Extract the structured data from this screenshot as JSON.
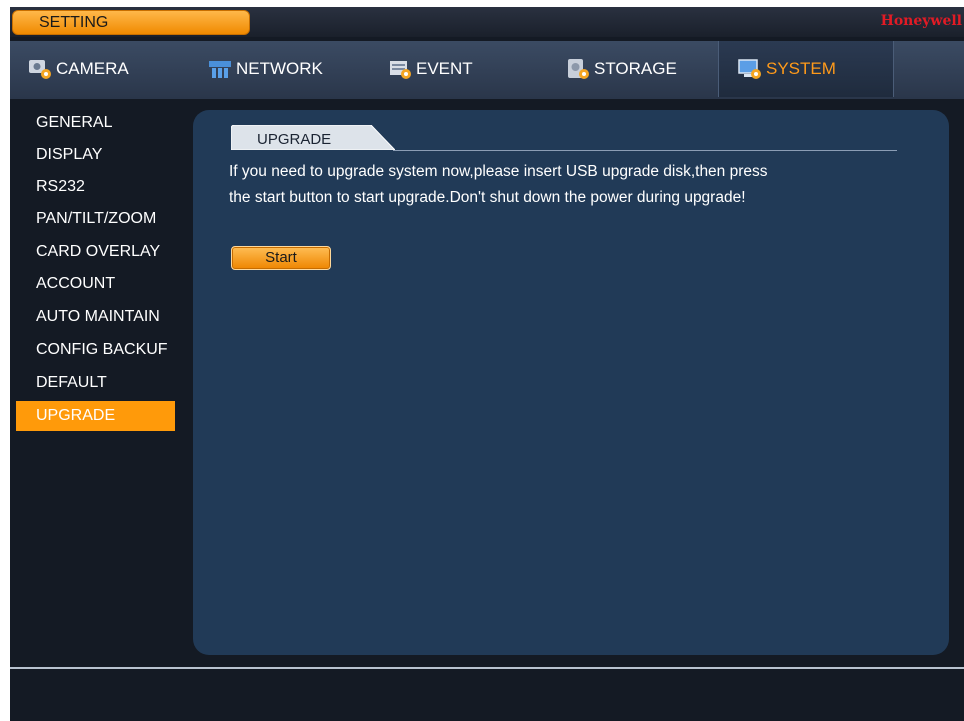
{
  "window": {
    "title": "SETTING",
    "brand": "Honeywell"
  },
  "tabs": [
    {
      "label": "CAMERA",
      "icon": "camera-icon"
    },
    {
      "label": "NETWORK",
      "icon": "network-icon"
    },
    {
      "label": "EVENT",
      "icon": "event-icon"
    },
    {
      "label": "STORAGE",
      "icon": "storage-icon"
    },
    {
      "label": "SYSTEM",
      "icon": "system-icon",
      "active": true
    }
  ],
  "sidebar": {
    "items": [
      {
        "label": "GENERAL"
      },
      {
        "label": "DISPLAY"
      },
      {
        "label": "RS232"
      },
      {
        "label": "PAN/TILT/ZOOM"
      },
      {
        "label": "CARD OVERLAY"
      },
      {
        "label": "ACCOUNT"
      },
      {
        "label": "AUTO MAINTAIN"
      },
      {
        "label": "CONFIG BACKUF"
      },
      {
        "label": "DEFAULT"
      },
      {
        "label": "UPGRADE",
        "active": true
      }
    ]
  },
  "upgrade": {
    "section_title": "UPGRADE",
    "message_line1": "If you need to upgrade system now,please insert USB upgrade disk,then press",
    "message_line2": "the start button to start upgrade.Don't shut down the power during upgrade!",
    "start_label": "Start"
  },
  "colors": {
    "accent": "#ff9a0a",
    "panel": "#213a57",
    "brand": "#e21b25",
    "background": "#141a24"
  }
}
